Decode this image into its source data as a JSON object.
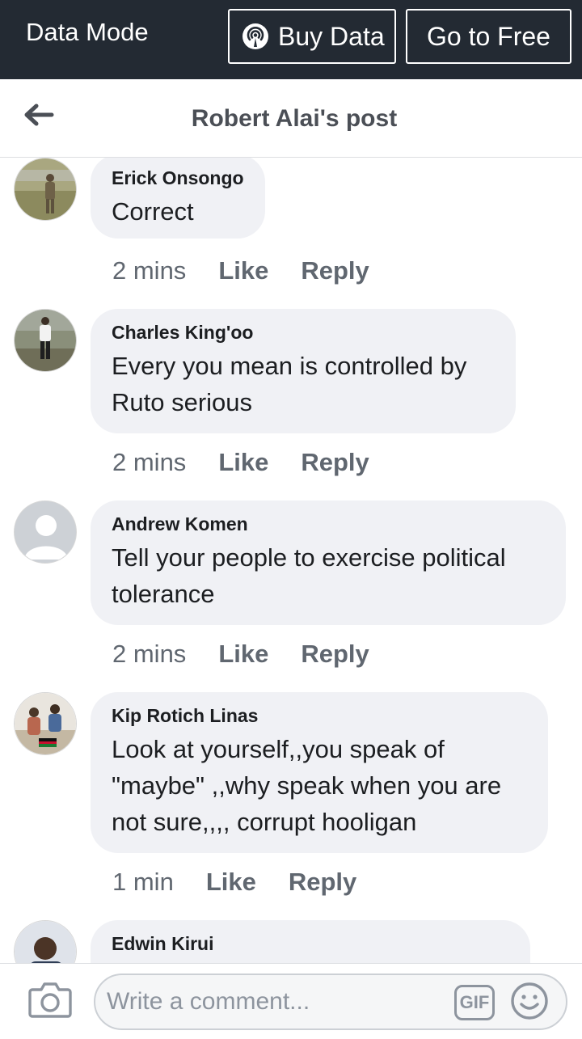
{
  "data_bar": {
    "mode_label": "Data Mode",
    "buy_data_label": "Buy Data",
    "go_free_label": "Go to Free"
  },
  "header": {
    "back_icon": "arrow-left-icon",
    "title": "Robert Alai's post"
  },
  "comments": [
    {
      "author": "Erick Onsongo",
      "text": "Correct",
      "time": "2 mins",
      "like_label": "Like",
      "reply_label": "Reply"
    },
    {
      "author": "Charles King'oo",
      "text": "Every you mean is controlled by Ruto serious",
      "time": "2 mins",
      "like_label": "Like",
      "reply_label": "Reply"
    },
    {
      "author": "Andrew Komen",
      "text": "Tell your people to exercise political tolerance",
      "time": "2 mins",
      "like_label": "Like",
      "reply_label": "Reply"
    },
    {
      "author": "Kip Rotich Linas",
      "text": "Look at yourself,,you speak of \"maybe\" ,,why speak when you are not sure,,,, corrupt hooligan",
      "time": "1 min",
      "like_label": "Like",
      "reply_label": "Reply"
    },
    {
      "author": "Edwin Kirui"
    }
  ],
  "composer": {
    "camera_icon": "camera-icon",
    "placeholder": "Write a comment...",
    "gif_label": "GIF",
    "emoji_icon": "smiley-icon"
  },
  "colors": {
    "data_bar_bg": "#232a33",
    "bubble_bg": "#f0f1f5",
    "secondary_text": "#606770",
    "title_text": "#4b4f56"
  }
}
